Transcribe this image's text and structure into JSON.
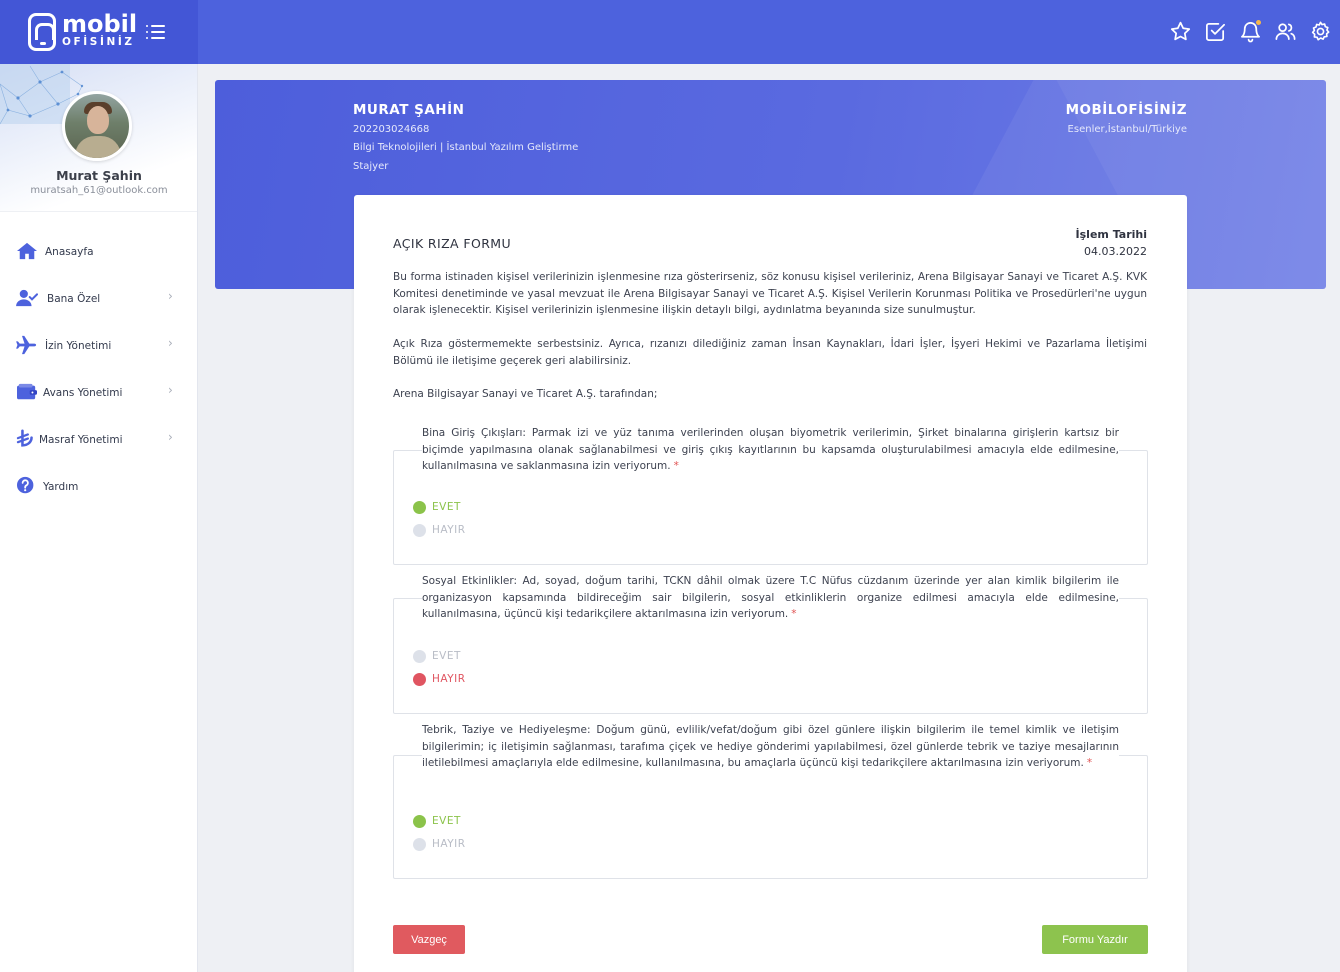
{
  "brand": {
    "logo_top": "mobil",
    "logo_bottom": "OFİSİNİZ"
  },
  "topbar": {
    "icons": [
      "star-icon",
      "check-square-icon",
      "bell-icon",
      "users-icon",
      "gear-icon"
    ],
    "accent_color": "#4d62dd"
  },
  "profile": {
    "name": "Murat Şahin",
    "email": "muratsah_61@outlook.com"
  },
  "sidebar": {
    "items": [
      {
        "label": "Anasayfa",
        "icon": "home-icon",
        "has_submenu": false
      },
      {
        "label": "Bana Özel",
        "icon": "user-check-icon",
        "has_submenu": true
      },
      {
        "label": "İzin Yönetimi",
        "icon": "plane-icon",
        "has_submenu": true
      },
      {
        "label": "Avans Yönetimi",
        "icon": "wallet-icon",
        "has_submenu": true
      },
      {
        "label": "Masraf Yönetimi",
        "icon": "lira-icon",
        "has_submenu": true
      },
      {
        "label": "Yardım",
        "icon": "help-icon",
        "has_submenu": false
      }
    ],
    "chevron": "›"
  },
  "banner": {
    "name": "MURAT ŞAHİN",
    "id": "202203024668",
    "department": "Bilgi Teknolojileri | İstanbul Yazılım Geliştirme",
    "role": "Stajyer",
    "company": "MOBİLOFİSİNİZ",
    "location": "Esenler,İstanbul/Türkiye"
  },
  "form": {
    "title": "AÇIK RIZA FORMU",
    "date_label": "İşlem Tarihi",
    "date_value": "04.03.2022",
    "paragraphs": [
      "Bu forma istinaden kişisel verilerinizin işlenmesine rıza gösterirseniz, söz konusu kişisel verileriniz, Arena Bilgisayar Sanayi ve Ticaret A.Ş. KVK Komitesi denetiminde ve yasal mevzuat ile Arena Bilgisayar Sanayi ve Ticaret A.Ş. Kişisel Verilerin Korunması Politika ve Prosedürleri'ne uygun olarak işlenecektir. Kişisel verilerinizin işlenmesine ilişkin detaylı bilgi, aydınlatma beyanında size sunulmuştur.",
      "Açık Rıza göstermemekte serbestsiniz. Ayrıca, rızanızı dilediğiniz zaman İnsan Kaynakları, İdari İşler, İşyeri Hekimi ve Pazarlama İletişimi Bölümü ile iletişime geçerek geri alabilirsiniz.",
      "Arena Bilgisayar Sanayi ve Ticaret A.Ş. tarafından;"
    ],
    "questions": [
      {
        "text": "Bina Giriş Çıkışları: Parmak izi ve yüz tanıma verilerinden oluşan biyometrik verilerimin, Şirket binalarına girişlerin kartsız bir biçimde yapılmasına olanak sağlanabilmesi ve giriş çıkış kayıtlarının bu kapsamda oluşturulabilmesi amacıyla elde edilmesine, kullanılmasına ve saklanmasına izin veriyorum.",
        "required_mark": "*",
        "options": [
          "EVET",
          "HAYIR"
        ],
        "selected": "EVET"
      },
      {
        "text": "Sosyal Etkinlikler: Ad, soyad, doğum tarihi, TCKN dâhil olmak üzere T.C Nüfus cüzdanım üzerinde yer alan kimlik bilgilerim ile organizasyon kapsamında bildireceğim sair bilgilerin, sosyal etkinliklerin organize edilmesi amacıyla elde edilmesine, kullanılmasına, üçüncü kişi tedarikçilere aktarılmasına izin veriyorum.",
        "required_mark": "*",
        "options": [
          "EVET",
          "HAYIR"
        ],
        "selected": "HAYIR"
      },
      {
        "text": "Tebrik, Taziye ve Hediyeleşme: Doğum günü, evlilik/vefat/doğum gibi özel günlere ilişkin bilgilerim ile temel kimlik ve iletişim bilgilerimin; iç iletişimin sağlanması, tarafıma çiçek ve hediye gönderimi yapılabilmesi, özel günlerde tebrik ve taziye mesajlarının iletilebilmesi amaçlarıyla elde edilmesine, kullanılmasına, bu amaçlarla üçüncü kişi tedarikçilere aktarılmasına izin veriyorum.",
        "required_mark": "*",
        "options": [
          "EVET",
          "HAYIR"
        ],
        "selected": "EVET"
      }
    ],
    "cancel_label": "Vazgeç",
    "print_label": "Formu Yazdır",
    "colors": {
      "yes": "#8bc34a",
      "no": "#e05561",
      "cancel": "#e05a5f",
      "print": "#8dc34e"
    }
  }
}
